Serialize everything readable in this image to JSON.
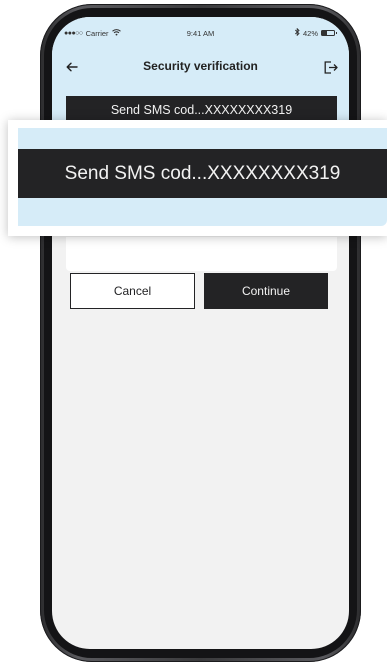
{
  "status_bar": {
    "signal_dots": "●●●○○",
    "carrier": "Carrier",
    "wifi_icon": "wifi-icon",
    "time": "9:41 AM",
    "bluetooth_icon": "bluetooth-icon",
    "battery_percent": "42%",
    "battery_level": 0.42
  },
  "nav": {
    "back_icon": "arrow-left-icon",
    "title": "Security verification",
    "logout_icon": "logout-icon"
  },
  "sms_button": {
    "label": "Send SMS cod...XXXXXXXX319"
  },
  "zoom_callout": {
    "label": "Send SMS cod...XXXXXXXX319"
  },
  "actions": {
    "cancel_label": "Cancel",
    "continue_label": "Continue"
  },
  "colors": {
    "header_tint": "#d6ecf8",
    "dark_button": "#232325",
    "screen_background": "#f2f2f2"
  }
}
